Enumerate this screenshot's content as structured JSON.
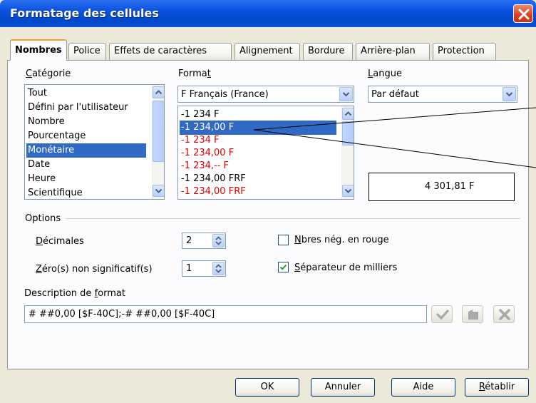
{
  "window": {
    "title": "Formatage des cellules"
  },
  "tabs": [
    {
      "label": "Nombres",
      "active": true
    },
    {
      "label": "Police",
      "active": false
    },
    {
      "label": "Effets de caractères",
      "active": false
    },
    {
      "label": "Alignement",
      "active": false
    },
    {
      "label": "Bordure",
      "active": false
    },
    {
      "label": "Arrière-plan",
      "active": false
    },
    {
      "label": "Protection",
      "active": false
    }
  ],
  "category": {
    "label": "Catégorie",
    "items": [
      "Tout",
      "Défini par l'utilisateur",
      "Nombre",
      "Pourcentage",
      "Monétaire",
      "Date",
      "Heure",
      "Scientifique"
    ],
    "selected": "Monétaire"
  },
  "format": {
    "label": "Format",
    "combo_value": "F Français (France)",
    "items": [
      {
        "text": "-1 234 F",
        "negative_red": false
      },
      {
        "text": "-1 234,00 F",
        "negative_red": false
      },
      {
        "text": "-1 234 F",
        "negative_red": true
      },
      {
        "text": "-1 234,00 F",
        "negative_red": true
      },
      {
        "text": "-1 234,-- F",
        "negative_red": true
      },
      {
        "text": "-1 234,00 FRF",
        "negative_red": false
      },
      {
        "text": "-1 234,00 FRF",
        "negative_red": true
      }
    ],
    "selected": "-1 234,00 F"
  },
  "language": {
    "label": "Langue",
    "value": "Par défaut"
  },
  "preview": {
    "value": "4 301,81 F"
  },
  "options": {
    "group_label": "Options",
    "decimals_label": "Décimales",
    "decimals_value": "2",
    "leading_zeros_label": "Zéro(s) non significatif(s)",
    "leading_zeros_value": "1",
    "negative_red_label": "Nbres nég. en rouge",
    "negative_red_checked": false,
    "thousands_sep_label": "Séparateur de milliers",
    "thousands_sep_checked": true
  },
  "format_code": {
    "label": "Description de format",
    "value": "# ##0,00 [$F-40C];-# ##0,00 [$F-40C]"
  },
  "buttons": {
    "ok": "OK",
    "cancel": "Annuler",
    "help": "Aide",
    "reset": "Rétablir"
  },
  "colors": {
    "title_bar": "#0a52e0",
    "selection": "#316ac5",
    "negative_red": "#e00000",
    "tab_highlight": "#f1a031"
  },
  "icons": [
    "close-icon",
    "checkmark-icon",
    "comment-icon",
    "delete-icon",
    "arrow-up-icon",
    "arrow-down-icon"
  ]
}
